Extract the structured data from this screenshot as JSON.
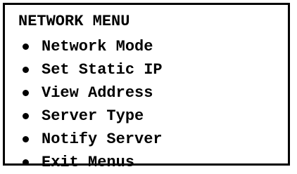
{
  "menu": {
    "title": "NETWORK MENU",
    "items": [
      {
        "label": "Network Mode"
      },
      {
        "label": "Set Static IP"
      },
      {
        "label": "View Address"
      },
      {
        "label": "Server Type"
      },
      {
        "label": "Notify Server"
      },
      {
        "label": "Exit Menus"
      }
    ]
  }
}
